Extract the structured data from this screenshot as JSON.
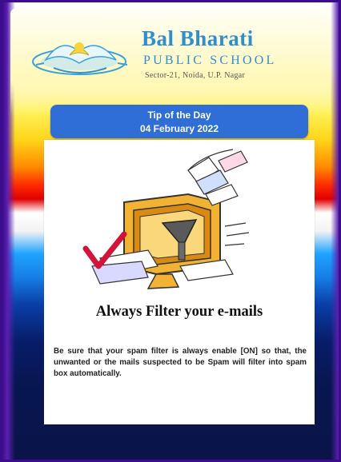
{
  "header": {
    "school_name": "Bal Bharati",
    "school_sub": "PUBLIC SCHOOL",
    "school_address": "Sector-21, Noida, U.P. Nagar"
  },
  "banner": {
    "line1": "Tip  of the Day",
    "line2": "04 February 2022"
  },
  "tip": {
    "heading": "Always Filter your e-mails",
    "body": "Be sure that your spam filter is always enable [ON] so that, the unwanted or the mails suspected to be Spam will filter into spam box automatically."
  },
  "icons": {
    "logo": "school-logo-icon",
    "illustration": "email-filter-illustration-icon"
  },
  "colors": {
    "banner": "#2f6ed6",
    "school_name": "#2b8fd0",
    "frame_border": "#3b0d8c"
  }
}
